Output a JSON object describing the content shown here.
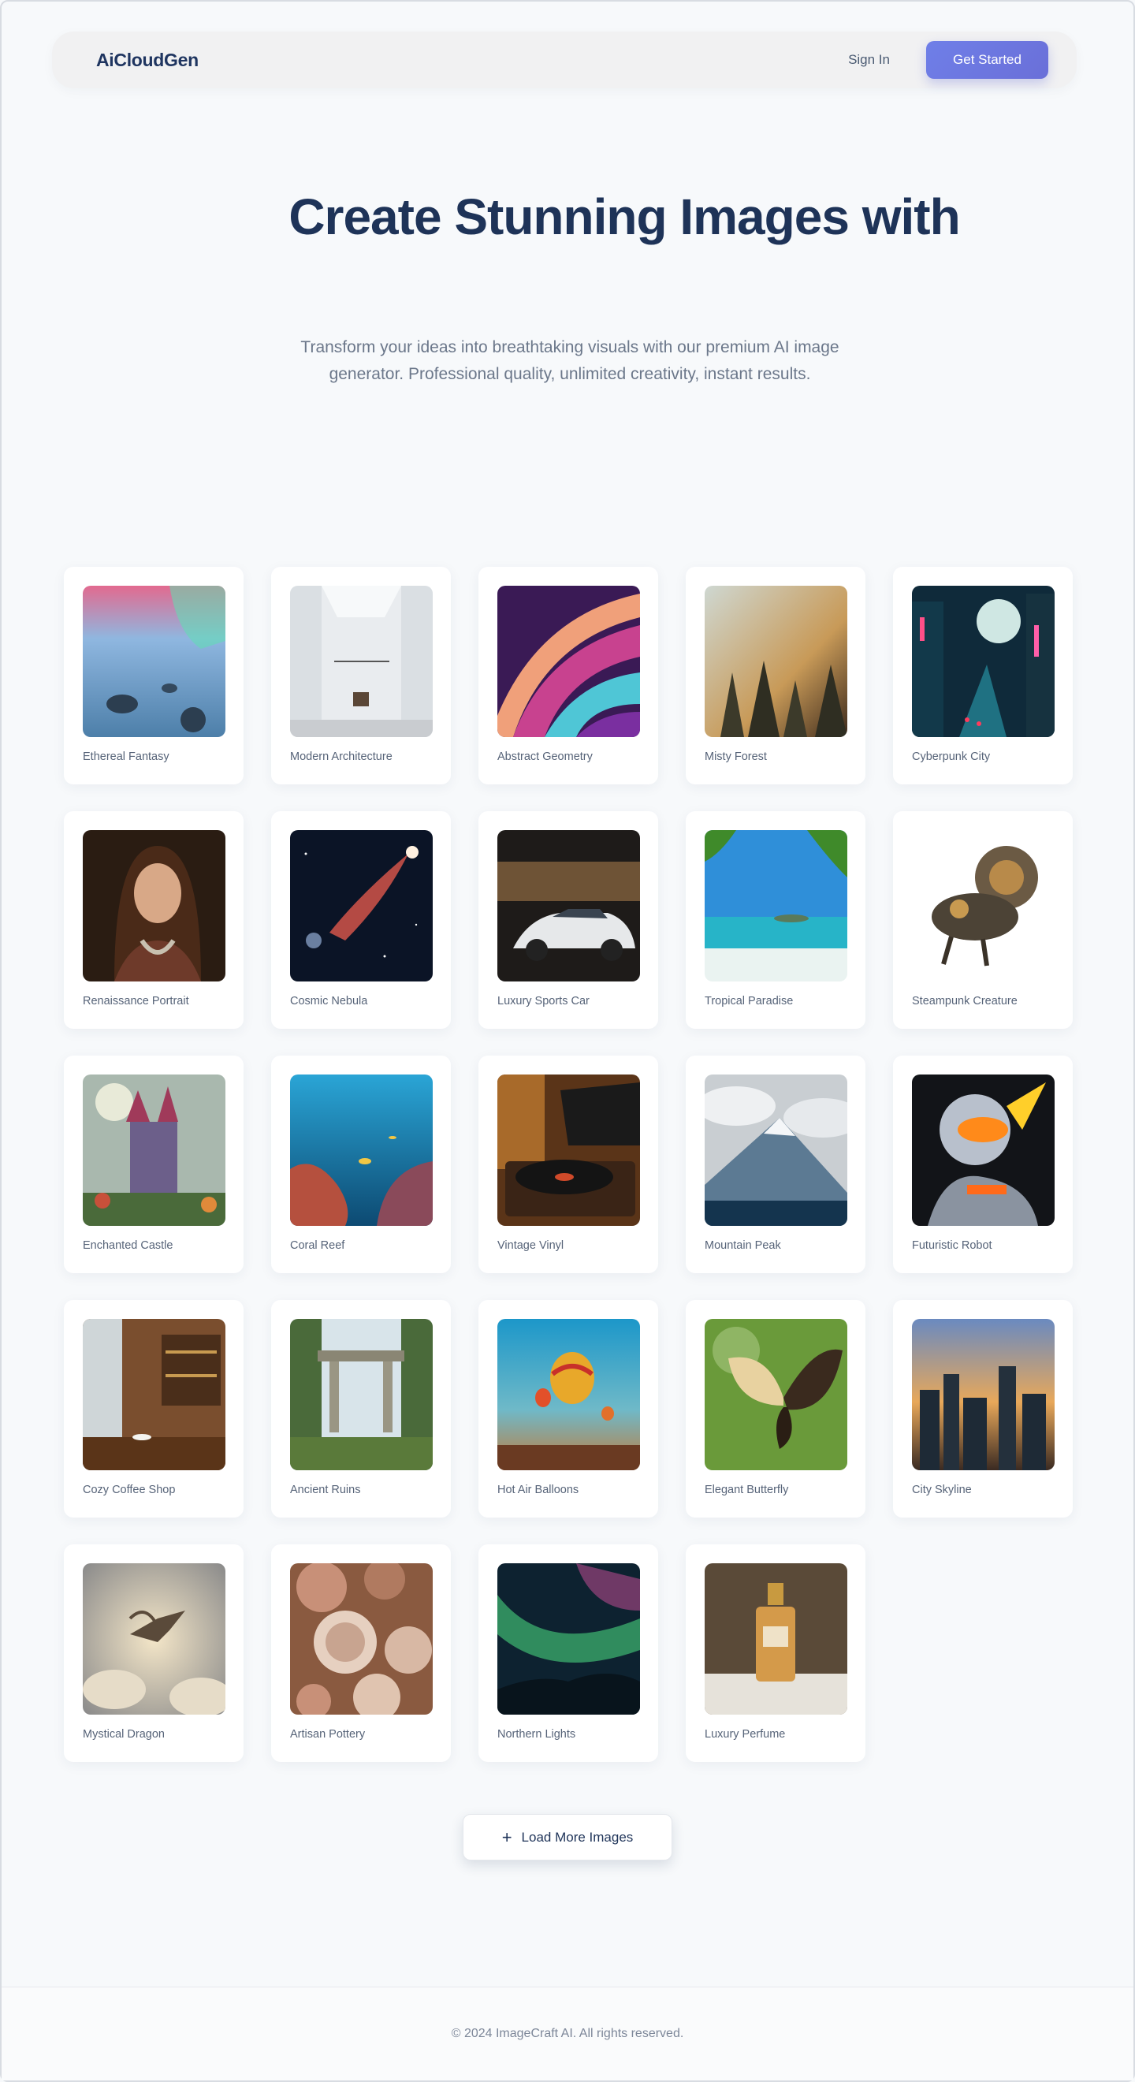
{
  "header": {
    "brand": "AiCloudGen",
    "signin_label": "Sign In",
    "cta_label": "Get Started"
  },
  "hero": {
    "title": "Create Stunning Images with",
    "subtitle": "Transform your ideas into breathtaking visuals with our premium AI image generator. Professional quality, unlimited creativity, instant results."
  },
  "gallery": {
    "items": [
      {
        "label": "Ethereal Fantasy",
        "icon": "aurora-image"
      },
      {
        "label": "Modern Architecture",
        "icon": "building-interior-image"
      },
      {
        "label": "Abstract Geometry",
        "icon": "abstract-swirl-image"
      },
      {
        "label": "Misty Forest",
        "icon": "forest-image"
      },
      {
        "label": "Cyberpunk City",
        "icon": "neon-city-image"
      },
      {
        "label": "Renaissance Portrait",
        "icon": "portrait-image"
      },
      {
        "label": "Cosmic Nebula",
        "icon": "nebula-image"
      },
      {
        "label": "Luxury Sports Car",
        "icon": "sports-car-image"
      },
      {
        "label": "Tropical Paradise",
        "icon": "beach-image"
      },
      {
        "label": "Steampunk Creature",
        "icon": "steampunk-image"
      },
      {
        "label": "Enchanted Castle",
        "icon": "castle-image"
      },
      {
        "label": "Coral Reef",
        "icon": "coral-reef-image"
      },
      {
        "label": "Vintage Vinyl",
        "icon": "record-player-image"
      },
      {
        "label": "Mountain Peak",
        "icon": "mountain-image"
      },
      {
        "label": "Futuristic Robot",
        "icon": "robot-image"
      },
      {
        "label": "Cozy Coffee Shop",
        "icon": "coffee-shop-image"
      },
      {
        "label": "Ancient Ruins",
        "icon": "ruins-image"
      },
      {
        "label": "Hot Air Balloons",
        "icon": "balloons-image"
      },
      {
        "label": "Elegant Butterfly",
        "icon": "butterfly-image"
      },
      {
        "label": "City Skyline",
        "icon": "skyline-image"
      },
      {
        "label": "Mystical Dragon",
        "icon": "dragon-image"
      },
      {
        "label": "Artisan Pottery",
        "icon": "pottery-image"
      },
      {
        "label": "Northern Lights",
        "icon": "northern-lights-image"
      },
      {
        "label": "Luxury Perfume",
        "icon": "perfume-image"
      }
    ]
  },
  "load_more": {
    "icon": "plus-icon",
    "label": "Load More Images"
  },
  "footer": {
    "copyright": "© 2024 ImageCraft AI. All rights reserved."
  },
  "colors": {
    "accent": "#6a74e0",
    "heading": "#1e3358",
    "background": "#f7f9fb"
  }
}
